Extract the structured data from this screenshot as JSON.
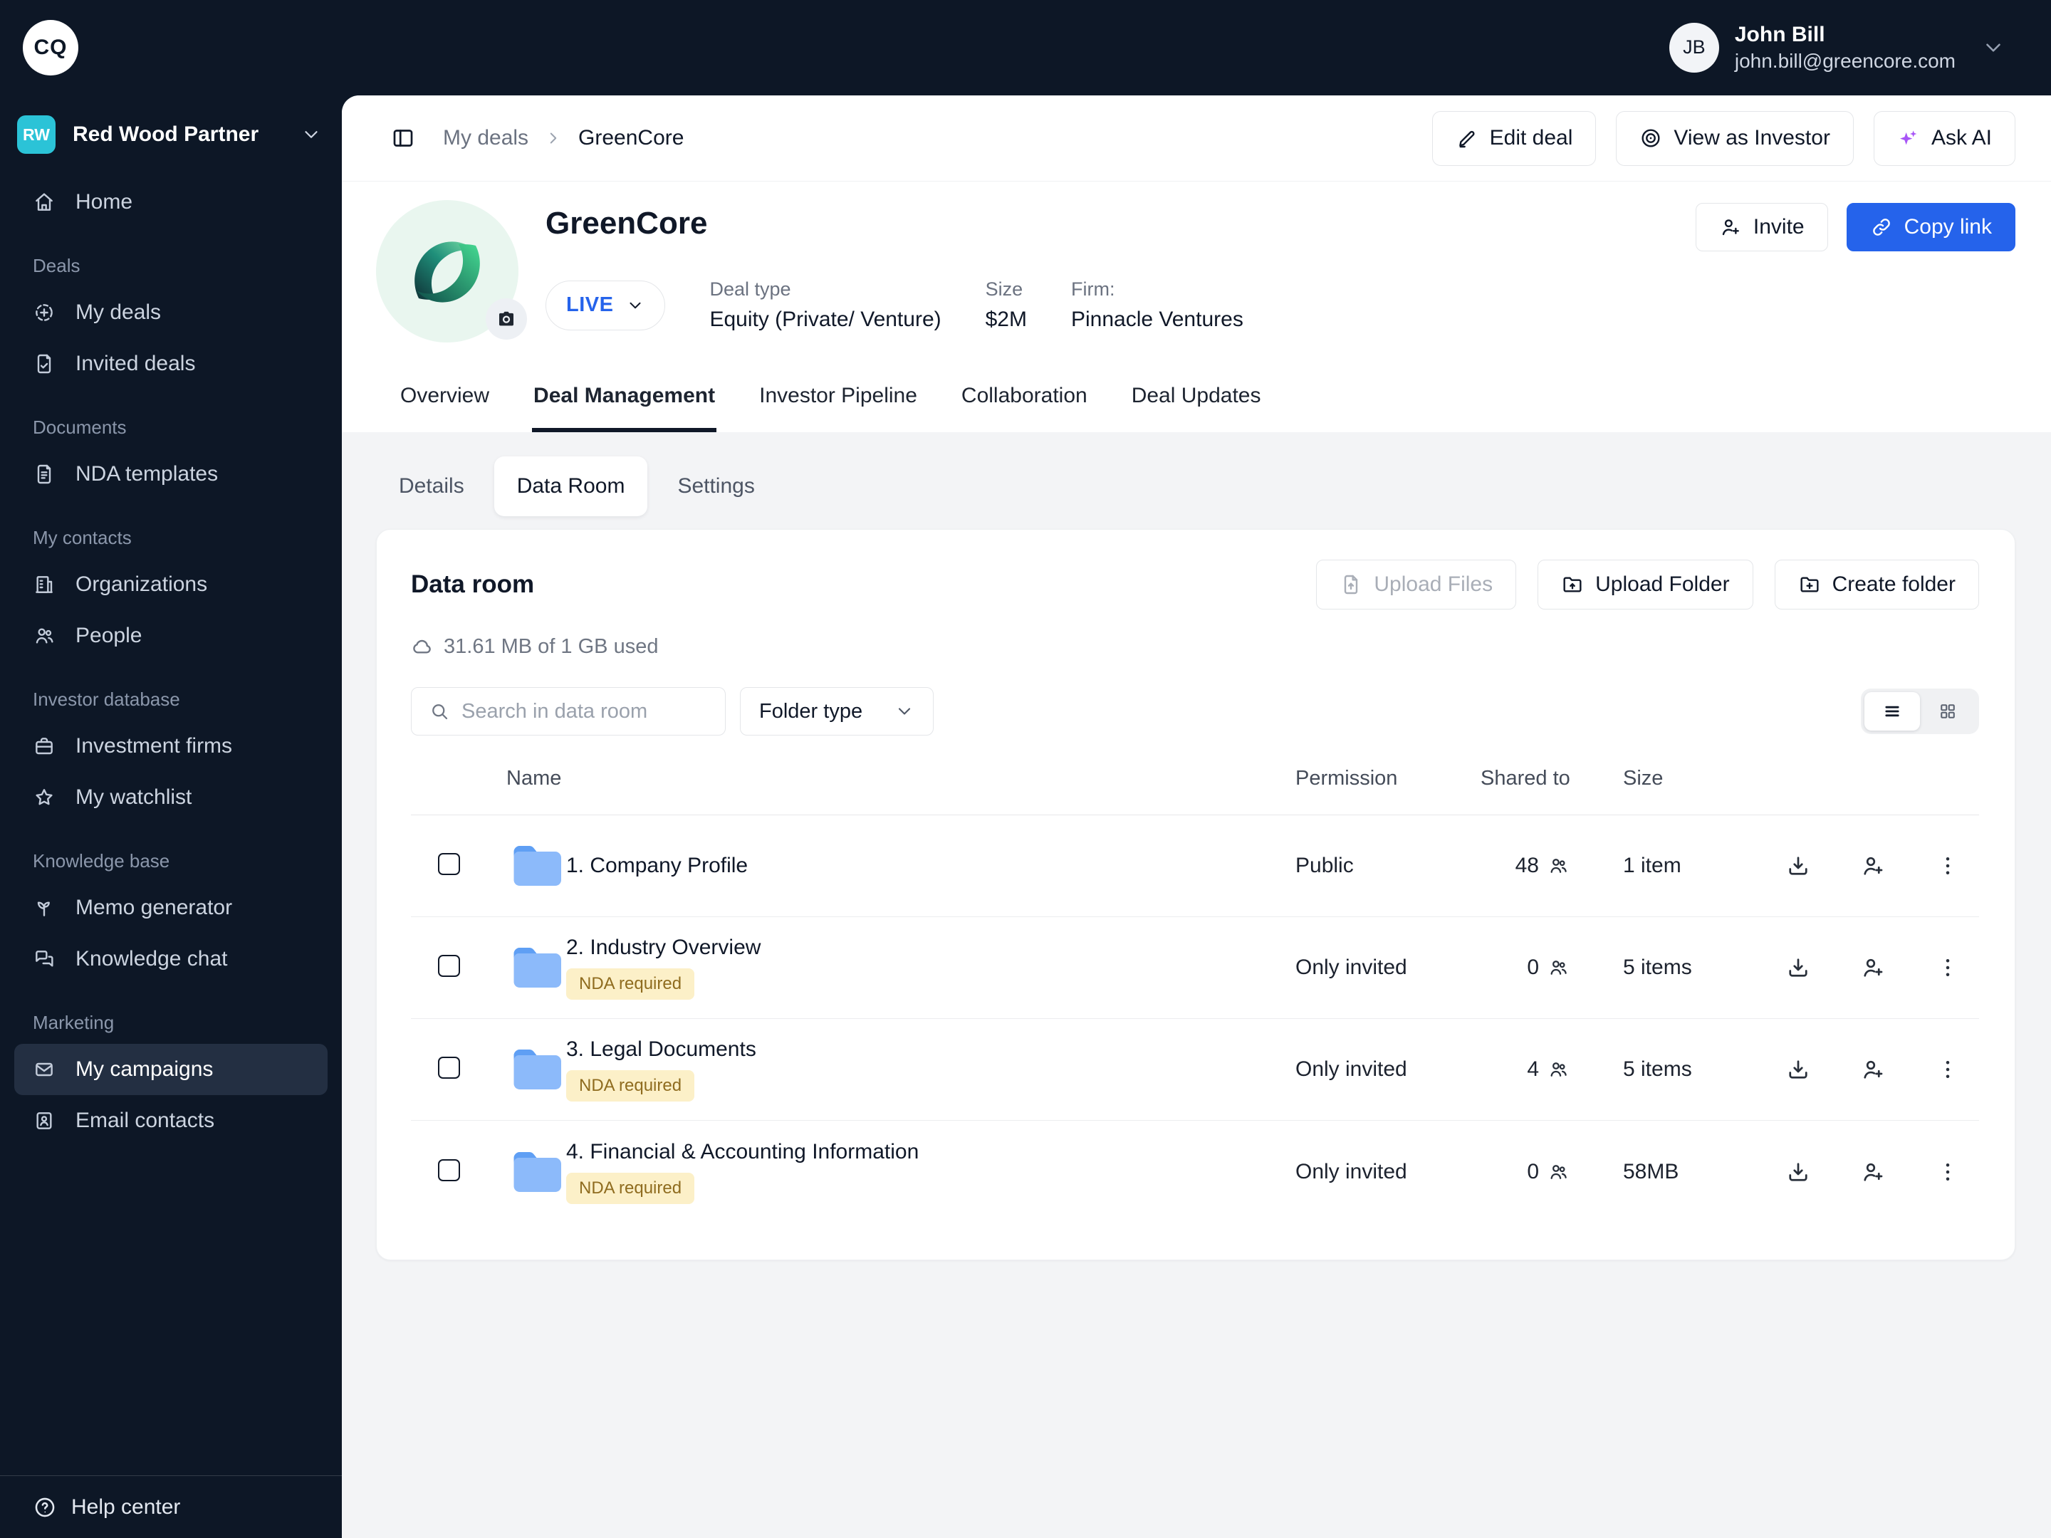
{
  "topbar": {
    "logo_text": "CQ",
    "user": {
      "initials": "JB",
      "name": "John Bill",
      "email": "john.bill@greencore.com"
    }
  },
  "sidebar": {
    "workspace": {
      "initials": "RW",
      "name": "Red Wood Partner"
    },
    "sections": [
      {
        "label": "",
        "items": [
          {
            "label": "Home",
            "icon": "home"
          }
        ]
      },
      {
        "label": "Deals",
        "items": [
          {
            "label": "My deals",
            "icon": "deal"
          },
          {
            "label": "Invited deals",
            "icon": "invited"
          }
        ]
      },
      {
        "label": "Documents",
        "items": [
          {
            "label": "NDA templates",
            "icon": "file-text"
          }
        ]
      },
      {
        "label": "My contacts",
        "items": [
          {
            "label": "Organizations",
            "icon": "building"
          },
          {
            "label": "People",
            "icon": "people"
          }
        ]
      },
      {
        "label": "Investor database",
        "items": [
          {
            "label": "Investment firms",
            "icon": "briefcase"
          },
          {
            "label": "My watchlist",
            "icon": "star"
          }
        ]
      },
      {
        "label": "Knowledge base",
        "items": [
          {
            "label": "Memo generator",
            "icon": "seedling"
          },
          {
            "label": "Knowledge chat",
            "icon": "chat"
          }
        ]
      },
      {
        "label": "Marketing",
        "items": [
          {
            "label": "My campaigns",
            "icon": "mail",
            "active": true
          },
          {
            "label": "Email contacts",
            "icon": "contact"
          }
        ]
      }
    ],
    "help_label": "Help center"
  },
  "breadcrumb": {
    "parent": "My deals",
    "current": "GreenCore"
  },
  "header_actions": {
    "edit": "Edit deal",
    "view_as": "View as Investor",
    "ask_ai": "Ask AI"
  },
  "deal": {
    "name": "GreenCore",
    "status": "LIVE",
    "deal_type_label": "Deal type",
    "deal_type": "Equity (Private/ Venture)",
    "size_label": "Size",
    "size": "$2M",
    "firm_label": "Firm:",
    "firm": "Pinnacle Ventures",
    "invite_label": "Invite",
    "copy_link_label": "Copy link"
  },
  "tabs": {
    "items": [
      "Overview",
      "Deal Management",
      "Investor Pipeline",
      "Collaboration",
      "Deal Updates"
    ],
    "active": "Deal Management"
  },
  "subtabs": {
    "items": [
      "Details",
      "Data Room",
      "Settings"
    ],
    "active": "Data Room"
  },
  "dataroom": {
    "title": "Data room",
    "storage": "31.61 MB of 1 GB used",
    "upload_files_label": "Upload Files",
    "upload_folder_label": "Upload Folder",
    "create_folder_label": "Create folder",
    "search_placeholder": "Search in data room",
    "filter_label": "Folder type",
    "table": {
      "columns": {
        "name": "Name",
        "permission": "Permission",
        "shared": "Shared to",
        "size": "Size"
      },
      "rows": [
        {
          "name": "1. Company Profile",
          "badge": null,
          "permission": "Public",
          "shared": "48",
          "size": "1 item"
        },
        {
          "name": "2. Industry Overview",
          "badge": "NDA required",
          "permission": "Only invited",
          "shared": "0",
          "size": "5 items"
        },
        {
          "name": "3. Legal Documents",
          "badge": "NDA required",
          "permission": "Only invited",
          "shared": "4",
          "size": "5 items"
        },
        {
          "name": "4. Financial & Accounting Information",
          "badge": "NDA required",
          "permission": "Only invited",
          "shared": "0",
          "size": "58MB"
        }
      ]
    }
  },
  "colors": {
    "dark_navy": "#0d1726",
    "accent_blue": "#2563eb",
    "teal_badge": "#2bc3d7",
    "folder_blue": "#8cbafa",
    "nda_bg": "#fcf0c8",
    "nda_text": "#8f6c1f",
    "live_text": "#2563eb",
    "ai_purple": "#a855f7"
  }
}
